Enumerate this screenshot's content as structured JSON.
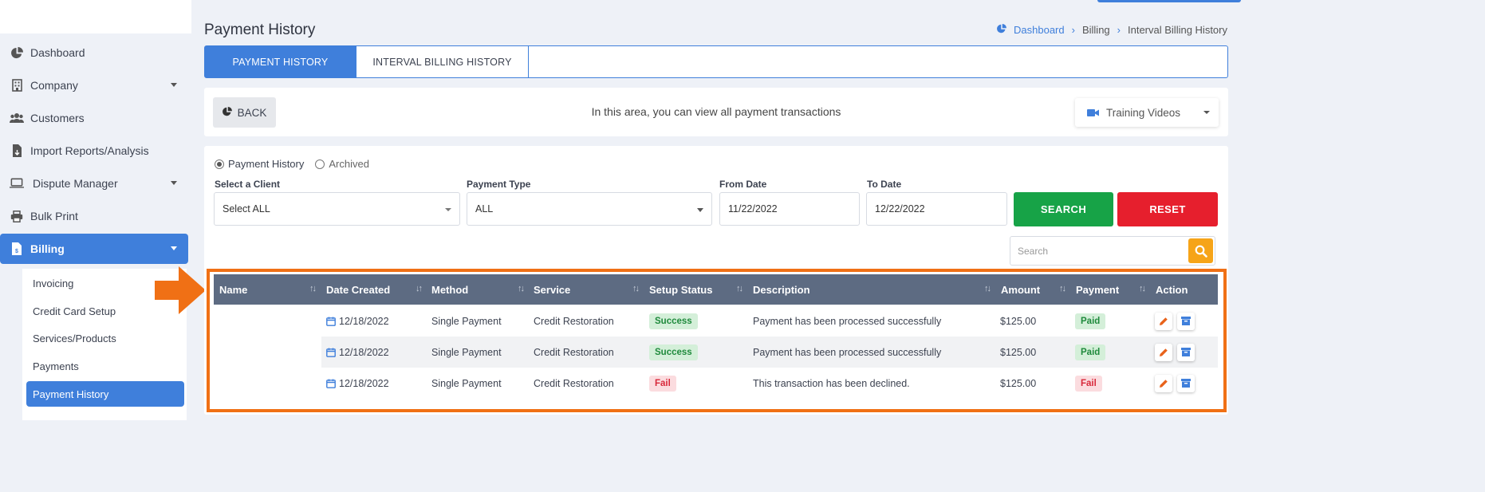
{
  "sidebar": {
    "items": [
      {
        "label": "Dashboard",
        "icon": "pie-chart-icon"
      },
      {
        "label": "Company",
        "icon": "building-icon"
      },
      {
        "label": "Customers",
        "icon": "users-icon"
      },
      {
        "label": "Import Reports/Analysis",
        "icon": "file-import-icon"
      },
      {
        "label": "Dispute Manager",
        "icon": "laptop-icon"
      },
      {
        "label": "Bulk Print",
        "icon": "printer-icon"
      },
      {
        "label": "Billing",
        "icon": "invoice-icon"
      }
    ],
    "submenu": [
      {
        "label": "Invoicing"
      },
      {
        "label": "Credit Card Setup"
      },
      {
        "label": "Services/Products"
      },
      {
        "label": "Payments"
      },
      {
        "label": "Payment History"
      }
    ]
  },
  "header": {
    "title": "Payment History",
    "breadcrumb": [
      "Dashboard",
      "Billing",
      "Interval Billing History"
    ]
  },
  "tabs": [
    {
      "label": "PAYMENT HISTORY"
    },
    {
      "label": "INTERVAL BILLING HISTORY"
    }
  ],
  "infobar": {
    "back_label": "BACK",
    "text": "In this area, you can view all payment transactions",
    "training_label": "Training Videos"
  },
  "filters": {
    "radio_selected": "Payment History",
    "radio_other": "Archived",
    "client_label": "Select a Client",
    "client_value": "Select ALL",
    "payment_type_label": "Payment Type",
    "payment_type_value": "ALL",
    "from_label": "From Date",
    "from_value": "11/22/2022",
    "to_label": "To Date",
    "to_value": "12/22/2022",
    "search_button": "SEARCH",
    "reset_button": "RESET",
    "search_placeholder": "Search"
  },
  "table": {
    "columns": [
      "Name",
      "Date Created",
      "Method",
      "Service",
      "Setup Status",
      "Description",
      "Amount",
      "Payment",
      "Action"
    ],
    "rows": [
      {
        "name": "",
        "date": "12/18/2022",
        "method": "Single Payment",
        "service": "Credit Restoration",
        "status": "Success",
        "description": "Payment has been processed successfully",
        "amount": "$125.00",
        "payment": "Paid"
      },
      {
        "name": "",
        "date": "12/18/2022",
        "method": "Single Payment",
        "service": "Credit Restoration",
        "status": "Success",
        "description": "Payment has been processed successfully",
        "amount": "$125.00",
        "payment": "Paid"
      },
      {
        "name": "",
        "date": "12/18/2022",
        "method": "Single Payment",
        "service": "Credit Restoration",
        "status": "Fail",
        "description": "This transaction has been declined.",
        "amount": "$125.00",
        "payment": "Fail"
      }
    ]
  },
  "colors": {
    "primary": "#3f7fdb",
    "success": "#17a347",
    "danger": "#e61f2d",
    "warning": "#f6a418",
    "highlight": "#f07015",
    "table_header": "#5d6b82"
  }
}
